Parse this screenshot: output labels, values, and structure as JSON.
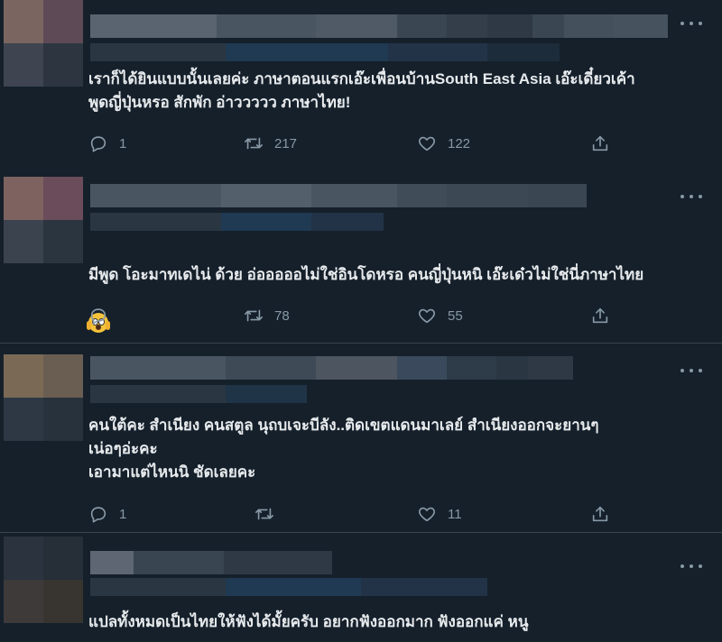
{
  "colors": {
    "background": "#15202b",
    "text": "#e8ebed",
    "muted": "#8899a6",
    "divider": "#38444d"
  },
  "tweets": [
    {
      "text": "เราก็ได้ยินแบบนั้นเลยค่ะ ภาษาตอนแรกเอ๊ะเพื่อนบ้านSouth East Asia เอ๊ะเดี๋ยวเค้า\nพูดญี่ปุ่นหรอ สักพัก อ่าววววว ภาษาไทย!",
      "reply_count": "1",
      "retweet_count": "217",
      "like_count": "122"
    },
    {
      "text": "มีพูด โอะมาทเดไน่ ด้วย อ่อออออไม่ใช่อินโดหรอ คนญี่ปุ่นหนิ เอ๊ะเด๋วไม่ใช่นี่ภาษาไทย",
      "emoji": "face-screaming-in-fear-emoji",
      "reply_count": "",
      "retweet_count": "78",
      "like_count": "55"
    },
    {
      "text": "คนใต้คะ สำเนียง คนสตูล นุถบเจะบีลัง..ติดเขตแดนมาเลย์ สำเนียงออกจะยานๆ\nเน่อๆอ่ะคะ\nเอามาแต่ไหนนิ ชัดเลยคะ",
      "reply_count": "1",
      "retweet_count": "",
      "like_count": "11"
    },
    {
      "text": "แปลทั้งหมดเป็นไทยให้ฟังได้มั้ยครับ อยากฟังออกมาก ฟังออกแค่ หนู"
    }
  ]
}
